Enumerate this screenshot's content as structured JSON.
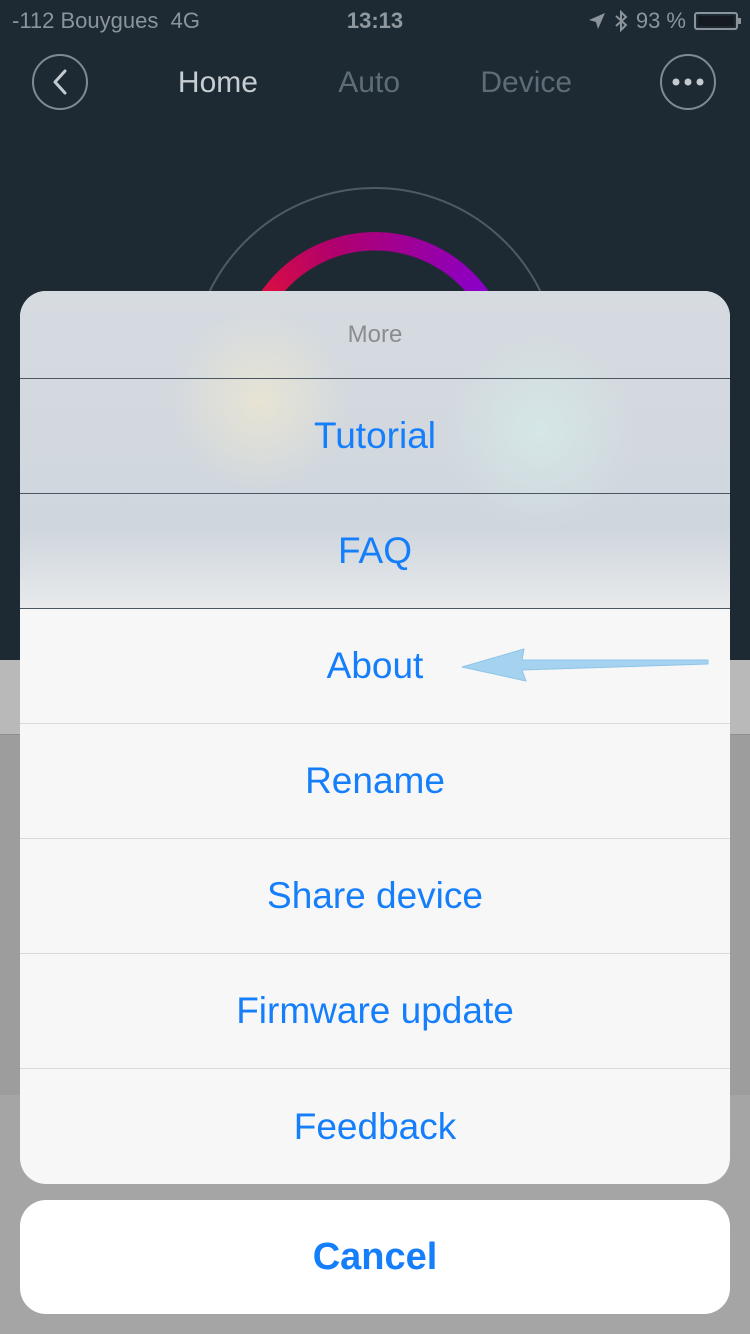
{
  "status_bar": {
    "carrier": "-112 Bouygues",
    "network": "4G",
    "time": "13:13",
    "battery": "93 %"
  },
  "nav": {
    "tabs": [
      {
        "label": "Home",
        "active": true
      },
      {
        "label": "Auto",
        "active": false
      },
      {
        "label": "Device",
        "active": false
      }
    ]
  },
  "action_sheet": {
    "title": "More",
    "items": [
      {
        "label": "Tutorial"
      },
      {
        "label": "FAQ"
      },
      {
        "label": "About"
      },
      {
        "label": "Rename"
      },
      {
        "label": "Share device"
      },
      {
        "label": "Firmware update"
      },
      {
        "label": "Feedback"
      }
    ],
    "cancel_label": "Cancel"
  },
  "colors": {
    "accent": "#157efb",
    "app_background": "#1e2a33",
    "annotation_arrow": "#a5d2ef"
  },
  "icons": {
    "back": "chevron-left-icon",
    "more": "ellipsis-icon",
    "location": "location-arrow-icon",
    "bluetooth": "bluetooth-icon",
    "battery": "battery-icon",
    "annotation": "pointer-arrow-icon"
  }
}
